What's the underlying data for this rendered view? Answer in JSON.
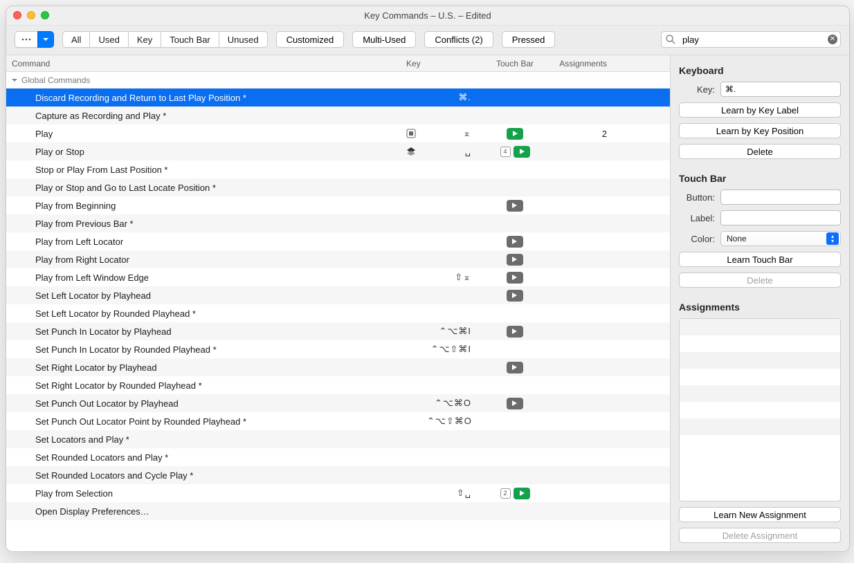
{
  "window": {
    "title": "Key Commands – U.S. – Edited"
  },
  "toolbar": {
    "filters": [
      "All",
      "Used",
      "Key",
      "Touch Bar",
      "Unused"
    ],
    "buttons": {
      "customized": "Customized",
      "multi_used": "Multi-Used",
      "conflicts": "Conflicts (2)",
      "pressed": "Pressed"
    }
  },
  "search": {
    "value": "play"
  },
  "columns": {
    "command": "Command",
    "key": "Key",
    "touchbar": "Touch Bar",
    "assignments": "Assignments"
  },
  "section_title": "Global Commands",
  "rows": [
    {
      "cmd": "Discard Recording and Return to Last Play Position *",
      "key": "⌘.",
      "tb_icons": [],
      "asn": "",
      "selected": true
    },
    {
      "cmd": "Capture as Recording and Play *",
      "key": "",
      "tb_icons": [],
      "asn": ""
    },
    {
      "cmd": "Play",
      "key": "⌅",
      "tb_icons": [
        "green"
      ],
      "asn": "2",
      "pre_icon": "enter-icon"
    },
    {
      "cmd": "Play or Stop",
      "key": "␣",
      "tb_icons": [
        "square4",
        "green"
      ],
      "asn": "",
      "pre_icon": "stack-icon"
    },
    {
      "cmd": "Stop or Play From Last Position *",
      "key": "",
      "tb_icons": [],
      "asn": ""
    },
    {
      "cmd": "Play or Stop and Go to Last Locate Position *",
      "key": "",
      "tb_icons": [],
      "asn": ""
    },
    {
      "cmd": "Play from Beginning",
      "key": "",
      "tb_icons": [
        "gray"
      ],
      "asn": ""
    },
    {
      "cmd": "Play from Previous Bar *",
      "key": "",
      "tb_icons": [],
      "asn": ""
    },
    {
      "cmd": "Play from Left Locator",
      "key": "",
      "tb_icons": [
        "gray"
      ],
      "asn": ""
    },
    {
      "cmd": "Play from Right Locator",
      "key": "",
      "tb_icons": [
        "gray"
      ],
      "asn": ""
    },
    {
      "cmd": "Play from Left Window Edge",
      "key": "⇧⌅",
      "tb_icons": [
        "gray"
      ],
      "asn": ""
    },
    {
      "cmd": "Set Left Locator by Playhead",
      "key": "",
      "tb_icons": [
        "gray"
      ],
      "asn": ""
    },
    {
      "cmd": "Set Left Locator by Rounded Playhead *",
      "key": "",
      "tb_icons": [],
      "asn": ""
    },
    {
      "cmd": "Set Punch In Locator by Playhead",
      "key": "⌃⌥⌘I",
      "tb_icons": [
        "gray"
      ],
      "asn": ""
    },
    {
      "cmd": "Set Punch In Locator by Rounded Playhead *",
      "key": "⌃⌥⇧⌘I",
      "tb_icons": [],
      "asn": ""
    },
    {
      "cmd": "Set Right Locator by Playhead",
      "key": "",
      "tb_icons": [
        "gray"
      ],
      "asn": ""
    },
    {
      "cmd": "Set Right Locator by Rounded Playhead *",
      "key": "",
      "tb_icons": [],
      "asn": ""
    },
    {
      "cmd": "Set Punch Out Locator by Playhead",
      "key": "⌃⌥⌘O",
      "tb_icons": [
        "gray"
      ],
      "asn": ""
    },
    {
      "cmd": "Set Punch Out Locator Point by Rounded Playhead *",
      "key": "⌃⌥⇧⌘O",
      "tb_icons": [],
      "asn": ""
    },
    {
      "cmd": "Set Locators and Play *",
      "key": "",
      "tb_icons": [],
      "asn": ""
    },
    {
      "cmd": "Set Rounded Locators and Play *",
      "key": "",
      "tb_icons": [],
      "asn": ""
    },
    {
      "cmd": "Set Rounded Locators and Cycle Play *",
      "key": "",
      "tb_icons": [],
      "asn": ""
    },
    {
      "cmd": "Play from Selection",
      "key": "⇧␣",
      "tb_icons": [
        "square2",
        "green"
      ],
      "asn": ""
    },
    {
      "cmd": "Open Display Preferences…",
      "key": "",
      "tb_icons": [],
      "asn": ""
    }
  ],
  "side": {
    "keyboard": {
      "heading": "Keyboard",
      "key_label": "Key:",
      "key_value": "⌘.",
      "learn_label": "Learn by Key Label",
      "learn_pos": "Learn by Key Position",
      "delete": "Delete"
    },
    "touchbar": {
      "heading": "Touch Bar",
      "button_label": "Button:",
      "button_value": "",
      "label_label": "Label:",
      "label_value": "",
      "color_label": "Color:",
      "color_value": "None",
      "learn": "Learn Touch Bar",
      "delete": "Delete"
    },
    "assignments": {
      "heading": "Assignments",
      "learn_new": "Learn New Assignment",
      "delete": "Delete Assignment"
    }
  }
}
